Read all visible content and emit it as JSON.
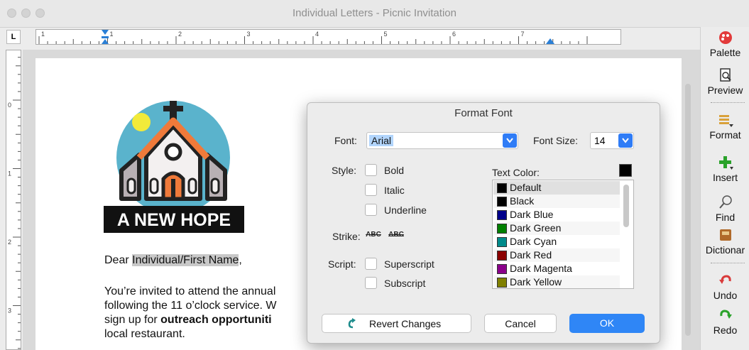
{
  "window": {
    "title": "Individual Letters - Picnic Invitation"
  },
  "ruler": {
    "corner_label": "L",
    "h_numbers": [
      "1",
      "1",
      "2",
      "3",
      "4",
      "5",
      "6",
      "7"
    ],
    "v_numbers": [
      "0",
      "1",
      "2",
      "3"
    ]
  },
  "document": {
    "logo_text": "A NEW HOPE",
    "salutation_prefix": "Dear ",
    "merge_field": "Individual/First Name",
    "salutation_suffix": ",",
    "lines": [
      "You’re invited to attend the annual",
      "following the 11  o’clock service. W",
      "sign up for ",
      "local restaurant."
    ],
    "bold_fragment": "outreach opportuniti"
  },
  "toolbar": {
    "items": [
      {
        "label": "Palette",
        "icon": "palette-icon"
      },
      {
        "label": "Preview",
        "icon": "preview-icon"
      },
      {
        "label": "Format",
        "icon": "format-icon"
      },
      {
        "label": "Insert",
        "icon": "insert-icon"
      },
      {
        "label": "Find",
        "icon": "find-icon"
      },
      {
        "label": "Dictionar",
        "icon": "dictionary-icon"
      },
      {
        "label": "Undo",
        "icon": "undo-icon"
      },
      {
        "label": "Redo",
        "icon": "redo-icon"
      }
    ]
  },
  "dialog": {
    "title": "Format Font",
    "font_label": "Font:",
    "font_value": "Arial",
    "font_size_label": "Font Size:",
    "font_size_value": "14",
    "style_label": "Style:",
    "styles": [
      "Bold",
      "Italic",
      "Underline"
    ],
    "strike_label": "Strike:",
    "strike_buttons": [
      "ABC",
      "ABC"
    ],
    "script_label": "Script:",
    "scripts": [
      "Superscript",
      "Subscript"
    ],
    "text_color_label": "Text Color:",
    "selected_color": "Default",
    "colors": [
      {
        "name": "Default",
        "hex": "#000000"
      },
      {
        "name": "Black",
        "hex": "#000000"
      },
      {
        "name": "Dark Blue",
        "hex": "#00008b"
      },
      {
        "name": "Dark Green",
        "hex": "#008000"
      },
      {
        "name": "Dark Cyan",
        "hex": "#008b8b"
      },
      {
        "name": "Dark Red",
        "hex": "#8b0000"
      },
      {
        "name": "Dark Magenta",
        "hex": "#8b008b"
      },
      {
        "name": "Dark Yellow",
        "hex": "#808000"
      }
    ],
    "revert_label": "Revert Changes",
    "cancel_label": "Cancel",
    "ok_label": "OK"
  }
}
